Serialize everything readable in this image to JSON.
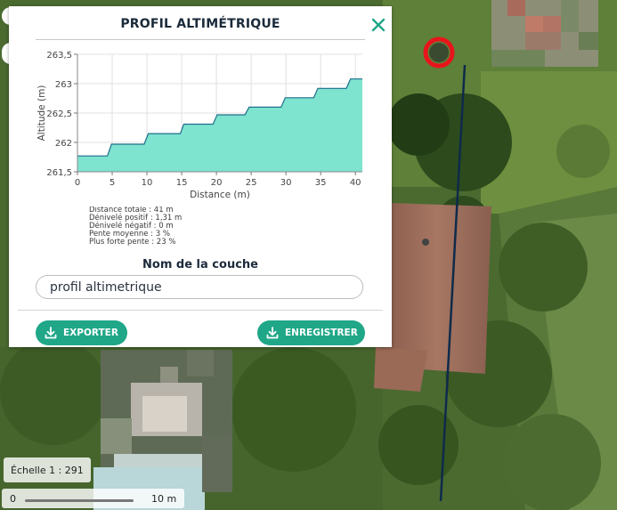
{
  "panel": {
    "title": "PROFIL ALTIMÉTRIQUE",
    "close_label": "close"
  },
  "chart_data": {
    "type": "area",
    "title": "",
    "xlabel": "Distance (m)",
    "ylabel": "Altitude (m)",
    "xlim": [
      0,
      41
    ],
    "ylim": [
      261.5,
      263.5
    ],
    "x_ticks": [
      "0",
      "5",
      "10",
      "15",
      "20",
      "25",
      "30",
      "35",
      "40"
    ],
    "y_ticks": [
      "261,5",
      "262",
      "262,5",
      "263",
      "263,5"
    ],
    "grid": true,
    "fill_color": "#7ee3cf",
    "line_color": "#1f6f8b",
    "x": [
      0,
      4.3,
      4.9,
      9.6,
      10.2,
      14.8,
      15.3,
      19.5,
      20.1,
      24.1,
      24.7,
      29.3,
      29.9,
      34.0,
      34.6,
      38.7,
      39.3,
      41.0
    ],
    "y": [
      261.77,
      261.77,
      261.97,
      261.97,
      262.15,
      262.15,
      262.31,
      262.31,
      262.47,
      262.47,
      262.6,
      262.6,
      262.76,
      262.76,
      262.92,
      262.92,
      263.08,
      263.08
    ]
  },
  "stats": [
    "Distance totale : 41 m",
    "Dénivelé positif : 1,31 m",
    "Dénivelé négatif : 0 m",
    "Pente moyenne : 3 %",
    "Plus forte pente : 23 %"
  ],
  "layer": {
    "label": "Nom de la couche",
    "value": "profil altimetrique"
  },
  "buttons": {
    "export": "EXPORTER",
    "save": "ENREGISTRER"
  },
  "scale": {
    "label": "Échelle 1 : 291",
    "start": "0",
    "end": "10 m"
  },
  "colors": {
    "accent": "#20a788",
    "title": "#1a2a3a",
    "marker": "#e8141c",
    "profile_line": "#0f2a4a"
  }
}
